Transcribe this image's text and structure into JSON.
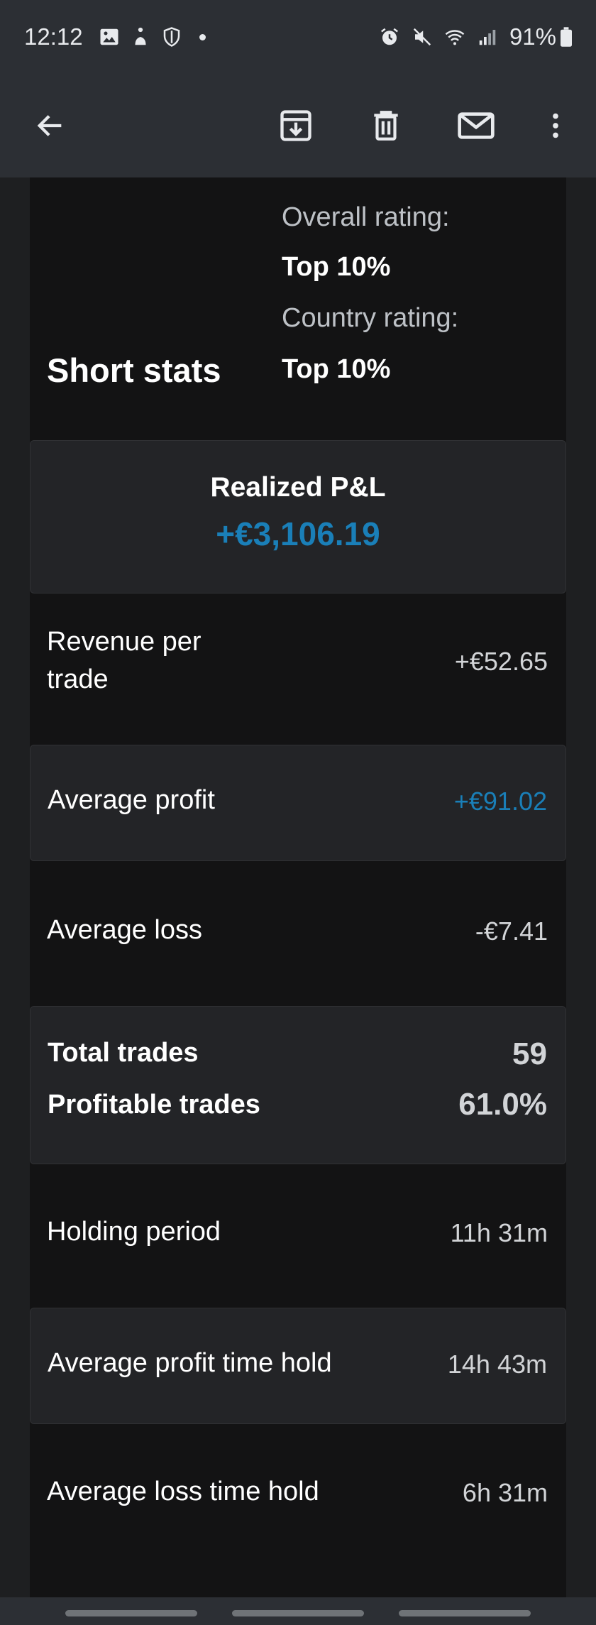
{
  "status_bar": {
    "time": "12:12",
    "battery": "91%",
    "left_icons": [
      "image-icon",
      "accessibility-icon",
      "shield-icon"
    ],
    "right_icons": [
      "alarm-icon",
      "mute-icon",
      "wifi-icon",
      "signal-icon",
      "battery-icon"
    ]
  },
  "app_bar": {
    "icons": [
      "back-arrow-icon",
      "archive-icon",
      "delete-icon",
      "mail-icon",
      "more-vert-icon"
    ]
  },
  "stats": {
    "title": "Short stats",
    "overall_rating_label": "Overall rating:",
    "overall_rating_value": "Top 10%",
    "country_rating_label": "Country rating:",
    "country_rating_value": "Top 10%"
  },
  "realized_pl": {
    "label": "Realized P&L",
    "value": "+€3,106.19",
    "value_color": "#1a7fb8"
  },
  "rows": {
    "revenue_per_trade": {
      "label_line1": "Revenue per",
      "label_line2": "trade",
      "value": "+€52.65"
    },
    "average_profit": {
      "label": "Average profit",
      "value": "+€91.02"
    },
    "average_loss": {
      "label": "Average loss",
      "value": "-€7.41"
    },
    "total_trades": {
      "label": "Total trades",
      "value": "59"
    },
    "profitable_trades": {
      "label": "Profitable trades",
      "value": "61.0%"
    },
    "holding_period": {
      "label": "Holding period",
      "value": "11h 31m"
    },
    "avg_profit_time_hold": {
      "label": "Average profit time hold",
      "value": "14h 43m"
    },
    "avg_loss_time_hold": {
      "label": "Average loss time hold",
      "value": "6h 31m"
    }
  },
  "colors": {
    "accent_blue": "#1a7fb8",
    "background": "#131314",
    "card": "#232427",
    "bar": "#2c2f34"
  }
}
